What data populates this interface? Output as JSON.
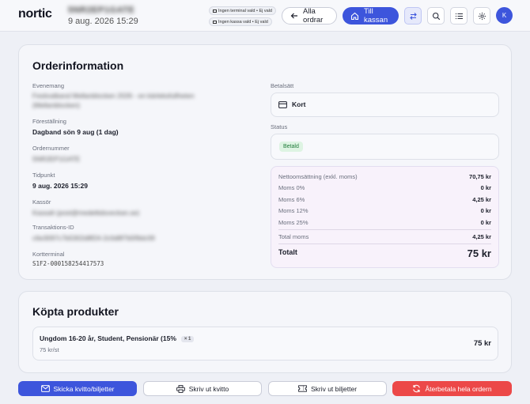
{
  "header": {
    "logo": "nortic",
    "order_id": "5NR2EP1GATE",
    "order_date": "9 aug. 2026 15:29",
    "terminal_chip": "Ingen terminal vald • Ej vald",
    "register_chip": "Ingen kassa vald • Ej vald",
    "all_orders_label": "Alla ordrar",
    "checkout_label": "Till kassan",
    "avatar_initial": "K"
  },
  "order_info": {
    "title": "Orderinformation",
    "event_label": "Evenemang",
    "event_value": "Festivalband Mellanblocken 2026 - en kärleksfullheten (Mellanblocken)",
    "performance_label": "Föreställning",
    "performance_value": "Dagband sön 9 aug (1 dag)",
    "ordernumber_label": "Ordernummer",
    "ordernumber_value": "5NR2EP1GATE",
    "time_label": "Tidpunkt",
    "time_value": "9 aug. 2026 15:29",
    "cashier_label": "Kassör",
    "cashier_value": "Kassalt (post@medeltidsveckan.se)",
    "transaction_label": "Transaktions-ID",
    "transaction_value": "c6e3097c7b5302d8f24-2c0d8f7b5f9dc09",
    "terminal_label": "Kortterminal",
    "terminal_value": "S1F2-000158254417573",
    "payment_label": "Betalsätt",
    "payment_value": "Kort",
    "status_label": "Status",
    "status_value": "Betald"
  },
  "summary": {
    "net_label": "Nettoomsättning (exkl. moms)",
    "net_value": "70,75 kr",
    "vat0_label": "Moms 0%",
    "vat0_value": "0 kr",
    "vat6_label": "Moms 6%",
    "vat6_value": "4,25 kr",
    "vat12_label": "Moms 12%",
    "vat12_value": "0 kr",
    "vat25_label": "Moms 25%",
    "vat25_value": "0 kr",
    "total_vat_label": "Total moms",
    "total_vat_value": "4,25 kr",
    "total_label": "Totalt",
    "total_value": "75 kr"
  },
  "products": {
    "title": "Köpta produkter",
    "items": [
      {
        "name": "Ungdom 16-20 år, Student, Pensionär (15%",
        "qty": "× 1",
        "unit_price": "75 kr/st",
        "total": "75 kr"
      }
    ]
  },
  "actions": {
    "send_receipt": "Skicka kvitto/biljetter",
    "print_receipt": "Skriv ut kvitto",
    "print_tickets": "Skriv ut biljetter",
    "refund": "Återbetala hela ordern"
  },
  "colors": {
    "accent": "#3d55dc",
    "danger": "#ec4848",
    "success_bg": "#def4e3",
    "success_text": "#1f7a3a"
  }
}
